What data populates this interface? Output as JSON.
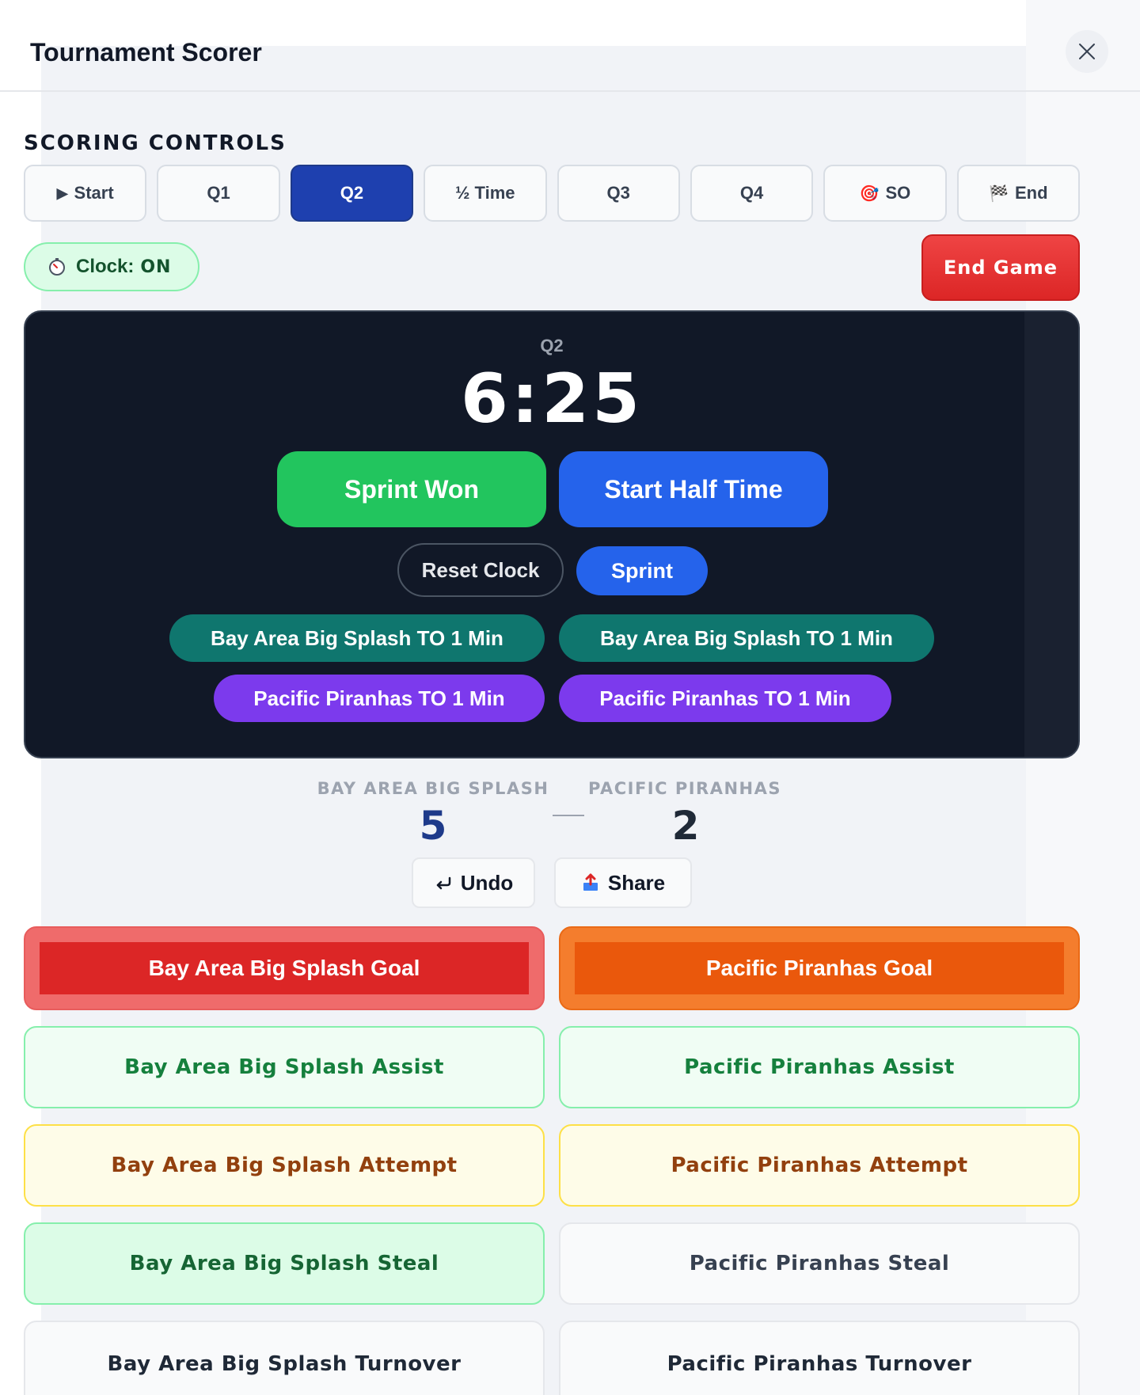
{
  "header": {
    "title": "Tournament Scorer"
  },
  "controls": {
    "section_label": "SCORING CONTROLS",
    "periods": [
      {
        "label": "Start",
        "icon": "play-icon",
        "glyph": "▶"
      },
      {
        "label": "Q1"
      },
      {
        "label": "Q2",
        "active": true
      },
      {
        "label": "½ Time"
      },
      {
        "label": "Q3"
      },
      {
        "label": "Q4"
      },
      {
        "label": "SO",
        "icon": "target-icon",
        "glyph": "🎯"
      },
      {
        "label": "End",
        "icon": "checkered-flag-icon",
        "glyph": "🏁"
      }
    ],
    "clock_label": "Clock:",
    "clock_status": "ON",
    "end_game": "End Game"
  },
  "clock": {
    "period": "Q2",
    "time": "6:25",
    "sprint_won": "Sprint Won",
    "start_half_time": "Start Half Time",
    "reset_clock": "Reset Clock",
    "sprint": "Sprint",
    "timeouts": {
      "team_a_1": "Bay Area Big Splash TO 1 Min",
      "team_a_2": "Bay Area Big Splash TO 1 Min",
      "team_b_1": "Pacific Piranhas TO 1 Min",
      "team_b_2": "Pacific Piranhas TO 1 Min"
    }
  },
  "scoreboard": {
    "team_a": {
      "name": "BAY AREA BIG SPLASH",
      "score": "5"
    },
    "team_b": {
      "name": "PACIFIC PIRANHAS",
      "score": "2"
    },
    "undo": "Undo",
    "share": "Share"
  },
  "actions": {
    "team_a": {
      "goal": "Bay Area Big Splash Goal",
      "assist": "Bay Area Big Splash Assist",
      "attempt": "Bay Area Big Splash Attempt",
      "steal": "Bay Area Big Splash Steal",
      "turnover": "Bay Area Big Splash Turnover"
    },
    "team_b": {
      "goal": "Pacific Piranhas Goal",
      "assist": "Pacific Piranhas Assist",
      "attempt": "Pacific Piranhas Attempt",
      "steal": "Pacific Piranhas Steal",
      "turnover": "Pacific Piranhas Turnover"
    }
  },
  "colors": {
    "active_period": "#1e40af",
    "end_game": "#dc2626",
    "sprint_won": "#22c55e",
    "start_half_time": "#2563eb",
    "timeout_team_a": "#0f766e",
    "timeout_team_b": "#7c3aed",
    "goal_team_a": "#dc2626",
    "goal_team_b": "#ea580c"
  }
}
